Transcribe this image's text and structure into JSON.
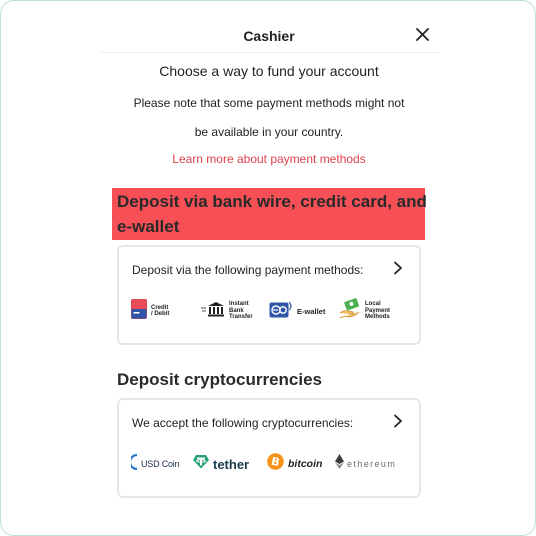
{
  "dialog": {
    "title": "Cashier",
    "subtitle": "Choose a way to fund your account",
    "note_line1": "Please note that some payment methods might not",
    "note_line2": "be available in your country.",
    "learn_more": "Learn more about payment methods"
  },
  "fiat_section": {
    "title_line1": "Deposit via bank wire, credit card, and",
    "title_line2": "e-wallet",
    "highlight_color": "#f74f56",
    "card_text": "Deposit via the following payment methods:",
    "methods": [
      {
        "icon": "credit-card-icon",
        "label_line1": "Credit",
        "label_line2": "/ Debit"
      },
      {
        "icon": "bank-icon",
        "label_line1": "Instant",
        "label_line2": "Bank",
        "label_line3": "Transfer"
      },
      {
        "icon": "ewallet-icon",
        "label": "E-wallet"
      },
      {
        "icon": "cash-hand-icon",
        "label_line1": "Local",
        "label_line2": "Payment",
        "label_line3": "Methods"
      }
    ]
  },
  "crypto_section": {
    "title": "Deposit cryptocurrencies",
    "card_text": "We accept the following cryptocurrencies:",
    "coins": [
      {
        "icon": "usd-coin-icon",
        "label": "USD Coin"
      },
      {
        "icon": "tether-icon",
        "label": "tether"
      },
      {
        "icon": "bitcoin-icon",
        "label": "bitcoin"
      },
      {
        "icon": "ethereum-icon",
        "label": "ethereum"
      }
    ]
  },
  "colors": {
    "link": "#e0424d",
    "border_frame": "#bfe1d9",
    "card_border": "#e6e6e6"
  }
}
